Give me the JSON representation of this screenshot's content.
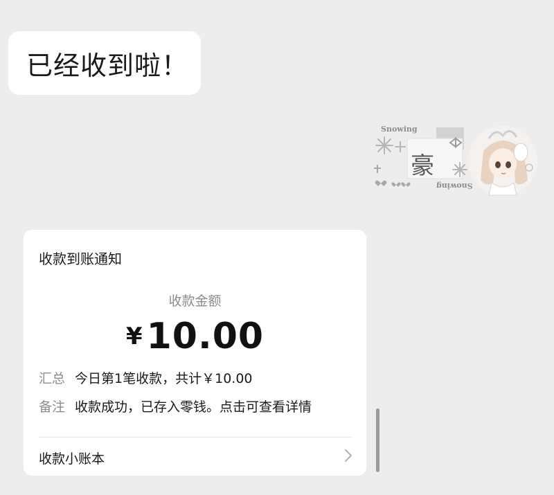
{
  "chat": {
    "incoming_text": "已经收到啦！"
  },
  "sticker": {
    "caption_top": "Snowing",
    "caption_bottom": "Snowing",
    "hanzi": "豪",
    "icon": "anime-girl-sticker"
  },
  "payment_card": {
    "title": "收款到账通知",
    "amount_label": "收款金额",
    "currency_symbol": "¥",
    "amount": "10.00",
    "summary_key": "汇总",
    "summary_value": "今日第1笔收款，共计￥10.00",
    "remark_key": "备注",
    "remark_value": "收款成功，已存入零钱。点击可查看详情",
    "ledger_link": "收款小账本",
    "ledger_icon": "chevron-right-icon"
  },
  "colors": {
    "chat_background": "#ededed",
    "bubble_background": "#ffffff",
    "primary_text": "#191919",
    "secondary_text": "#8c8c8c"
  }
}
